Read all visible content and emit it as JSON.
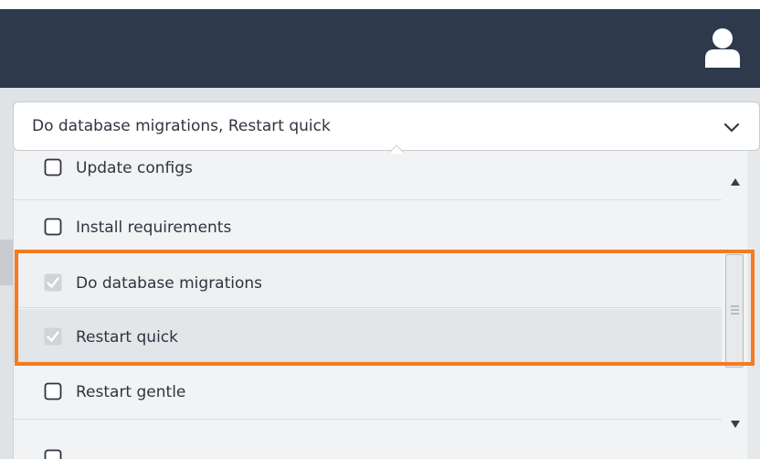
{
  "header": {
    "user_icon": "user-icon"
  },
  "select": {
    "value": "Do database migrations, Restart quick",
    "chevron_icon": "chevron-down-icon"
  },
  "options": [
    {
      "label": "Update configs",
      "checked": false
    },
    {
      "label": "Install requirements",
      "checked": false
    },
    {
      "label": "Do database migrations",
      "checked": true
    },
    {
      "label": "Restart quick",
      "checked": true
    },
    {
      "label": "Restart gentle",
      "checked": false
    }
  ],
  "colors": {
    "topbar": "#2e3a4c",
    "highlight": "#f47b20",
    "background": "#dfe3e6",
    "dropdown": "#f1f3f4"
  }
}
